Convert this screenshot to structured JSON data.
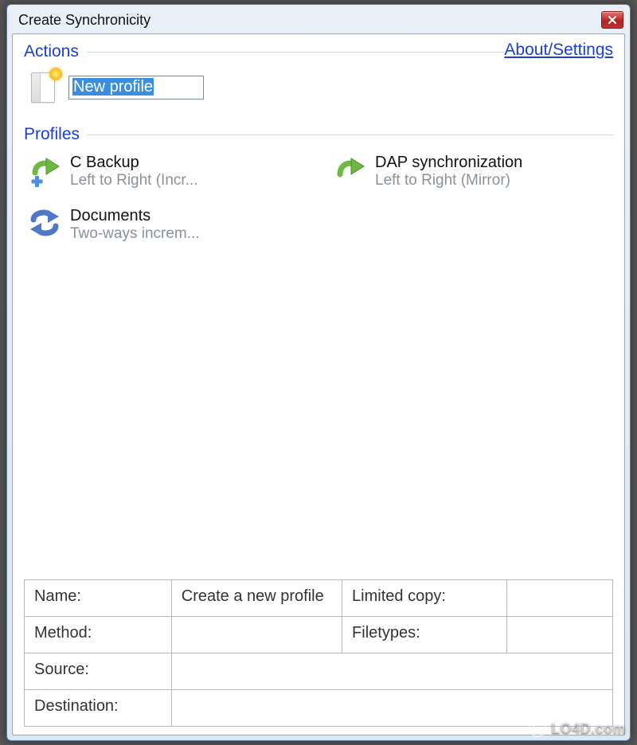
{
  "window": {
    "title": "Create Synchronicity"
  },
  "header": {
    "actions_label": "Actions",
    "about_link": "About/Settings",
    "profiles_label": "Profiles"
  },
  "new_profile": {
    "value": "New profile"
  },
  "profiles": [
    {
      "name": "C Backup",
      "desc": "Left to Right (Incr...",
      "icon": "arrow-add"
    },
    {
      "name": "DAP synchronization",
      "desc": "Left to Right (Mirror)",
      "icon": "arrow-right"
    },
    {
      "name": "Documents",
      "desc": "Two-ways increm...",
      "icon": "two-way"
    }
  ],
  "info": {
    "name_label": "Name:",
    "name_value": "Create a new profile",
    "limited_label": "Limited copy:",
    "limited_value": "",
    "method_label": "Method:",
    "method_value": "",
    "filetypes_label": "Filetypes:",
    "filetypes_value": "",
    "source_label": "Source:",
    "source_value": "",
    "dest_label": "Destination:",
    "dest_value": ""
  },
  "watermark": "LO4D.com"
}
